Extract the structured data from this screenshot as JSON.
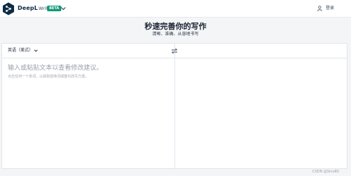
{
  "header": {
    "brand_name": "DeepL",
    "brand_product": "Write",
    "beta_badge": "BETA",
    "login_label": "登录"
  },
  "hero": {
    "title": "秒速完善你的写作",
    "subtitle": "清晰、准确、从容地书写"
  },
  "editor": {
    "language_select": "英语（美式）",
    "input_placeholder": "输入或粘贴文本以查看修改建议。",
    "input_hint": "点击任何一个单词，以获取替换词或整句改写方案。"
  },
  "watermark": "CSDN @Sino80",
  "colors": {
    "brand_navy": "#0f2b46",
    "beta_green": "#0f9a76",
    "page_bg": "#f4f5f7"
  },
  "icons": {
    "logo": "deepl-logo-icon",
    "product_menu": "chevron-down-icon",
    "login": "user-icon",
    "language_menu": "chevron-down-icon",
    "swap": "swap-arrows-icon"
  }
}
